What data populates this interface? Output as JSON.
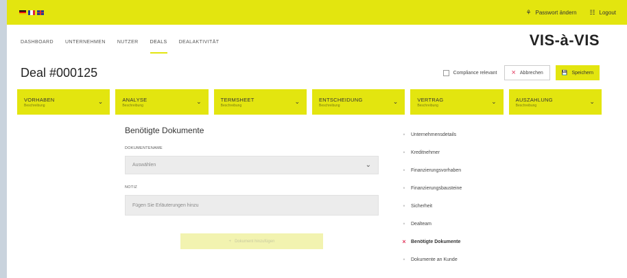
{
  "topbar": {
    "languages": [
      "de",
      "fr",
      "en"
    ],
    "password_label": "Passwort ändern",
    "logout_label": "Logout"
  },
  "nav": {
    "items": [
      "DASHBOARD",
      "UNTERNEHMEN",
      "NUTZER",
      "DEALS",
      "DEALAKTIVITÄT"
    ],
    "active": "DEALS",
    "brand": "VIS-à-VIS"
  },
  "deal": {
    "title": "Deal #000125",
    "compliance_label": "Compliance relevant",
    "cancel_label": "Abbrechen",
    "save_label": "Speichern"
  },
  "stages": [
    {
      "label": "VORHABEN",
      "sub": "Beschreibung"
    },
    {
      "label": "ANALYSE",
      "sub": "Beschreibung"
    },
    {
      "label": "TERMSHEET",
      "sub": "Beschreibung"
    },
    {
      "label": "ENTSCHEIDUNG",
      "sub": "Beschreibung"
    },
    {
      "label": "VERTRAG",
      "sub": "Beschreibung"
    },
    {
      "label": "AUSZAHLUNG",
      "sub": "Beschreibung"
    }
  ],
  "form": {
    "section_title": "Benötigte Dokumente",
    "doc_label": "DOKUMENTENAME",
    "doc_placeholder": "Auswählen",
    "note_label": "NOTIZ",
    "note_placeholder": "Fügen Sie Erläuterungen hinzu",
    "submit_label": "Dokument hinzufügen"
  },
  "side_menu": {
    "items": [
      "Unternehmensdetails",
      "Kreditnehmer",
      "Finanzierungsvorhaben",
      "Finanzierungsbausteine",
      "Sicherheit",
      "Dealteam",
      "Benötigte Dokumente",
      "Dokumente an Kunde"
    ],
    "active_index": 6
  },
  "colors": {
    "accent": "#e3e50f",
    "active_marker": "#e23a5e"
  }
}
